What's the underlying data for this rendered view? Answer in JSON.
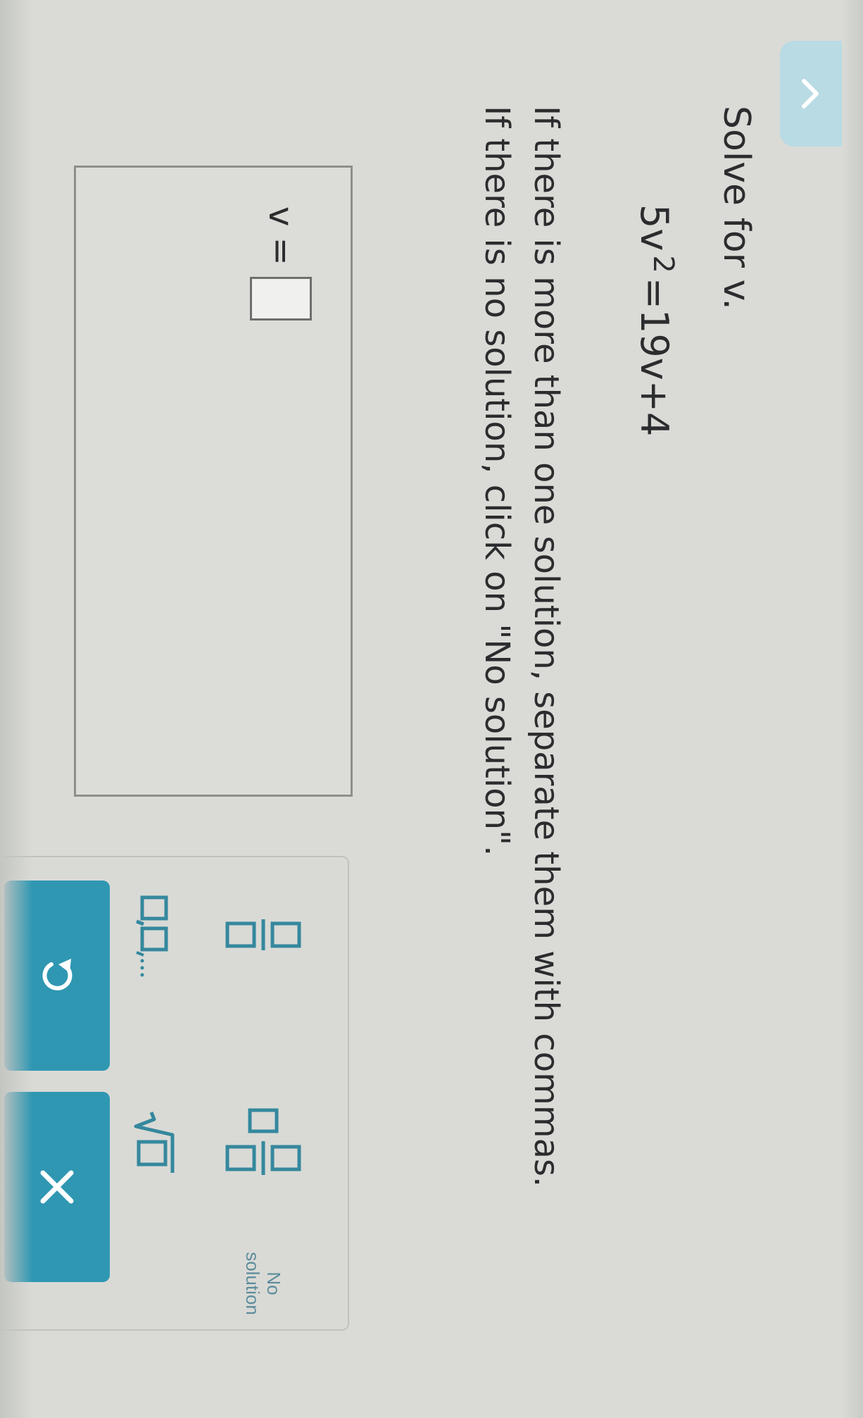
{
  "question": {
    "title": "Solve for v.",
    "equation": {
      "lhs_coef": "5v",
      "exponent": "2",
      "rhs": "=19v+4"
    },
    "instructions_line1": "If there is more than one solution, separate them with commas.",
    "instructions_line2": "If there is no solution, click on \"No solution\"."
  },
  "answer": {
    "label": "v =",
    "value": ""
  },
  "keypad": {
    "keys": [
      {
        "name": "fraction",
        "icon": "fraction-icon"
      },
      {
        "name": "mixed-number",
        "icon": "mixed-number-icon"
      },
      {
        "name": "no-solution",
        "label_line1": "No",
        "label_line2": "solution"
      },
      {
        "name": "list",
        "icon": "comma-list-icon"
      },
      {
        "name": "square-root",
        "icon": "sqrt-icon"
      }
    ]
  },
  "actions": {
    "undo_icon": "undo-icon",
    "clear_icon": "close-icon",
    "clear_label": "×"
  },
  "colors": {
    "accent": "#2f97b2",
    "keypad_icon": "#35889d",
    "tab": "#b8dbe4"
  }
}
